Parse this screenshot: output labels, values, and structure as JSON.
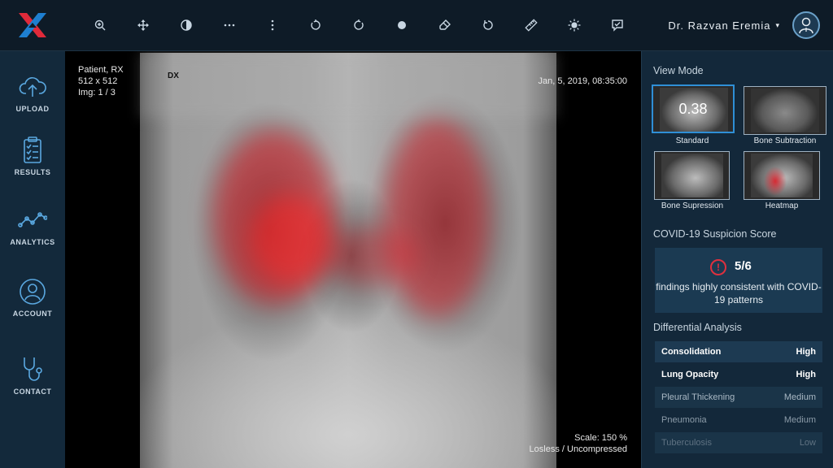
{
  "header": {
    "tools": [
      "zoom-in-icon",
      "move-icon",
      "contrast-icon",
      "more-horizontal-icon",
      "more-vertical-icon",
      "rotate-left-icon",
      "rotate-right-icon",
      "record-icon",
      "eraser-icon",
      "reset-icon",
      "ruler-icon",
      "brightness-icon",
      "check-report-icon"
    ],
    "user_name": "Dr. Razvan Eremia",
    "caret": "▾"
  },
  "sidebar": {
    "items": [
      {
        "label": "UPLOAD",
        "icon": "cloud-upload-icon"
      },
      {
        "label": "RESULTS",
        "icon": "clipboard-icon"
      },
      {
        "label": "ANALYTICS",
        "icon": "analytics-line-icon"
      },
      {
        "label": "ACCOUNT",
        "icon": "user-icon"
      },
      {
        "label": "CONTACT",
        "icon": "stethoscope-icon"
      }
    ]
  },
  "viewer": {
    "patient": "Patient, RX",
    "size": "512 x 512",
    "img": "Img: 1 / 3",
    "tag": "DX",
    "datetime": "Jan, 5, 2019, 08:35:00",
    "scale": "Scale: 150 %",
    "compression": "Losless / Uncompressed"
  },
  "panel": {
    "view_mode_title": "View Mode",
    "modes": [
      {
        "label": "Standard",
        "value": "0.38",
        "active": true
      },
      {
        "label": "Bone Subtraction"
      },
      {
        "label": "Bone Supression"
      },
      {
        "label": "Heatmap"
      }
    ],
    "covid_title": "COVID-19 Suspicion Score",
    "covid_count": "5/6",
    "covid_desc": "findings highly consistent with COVID-19 patterns",
    "diff_title": "Differential Analysis",
    "findings": [
      {
        "name": "Consolidation",
        "level": "High"
      },
      {
        "name": "Lung Opacity",
        "level": "High"
      },
      {
        "name": "Pleural Thickening",
        "level": "Medium"
      },
      {
        "name": "Pneumonia",
        "level": "Medium"
      },
      {
        "name": "Tuberculosis",
        "level": "Low"
      }
    ]
  },
  "colors": {
    "accent": "#2f8fd6",
    "alert": "#e0303e",
    "logo_red": "#e02a3a",
    "logo_blue": "#1e7fd0",
    "panel_bg": "#13283a"
  }
}
